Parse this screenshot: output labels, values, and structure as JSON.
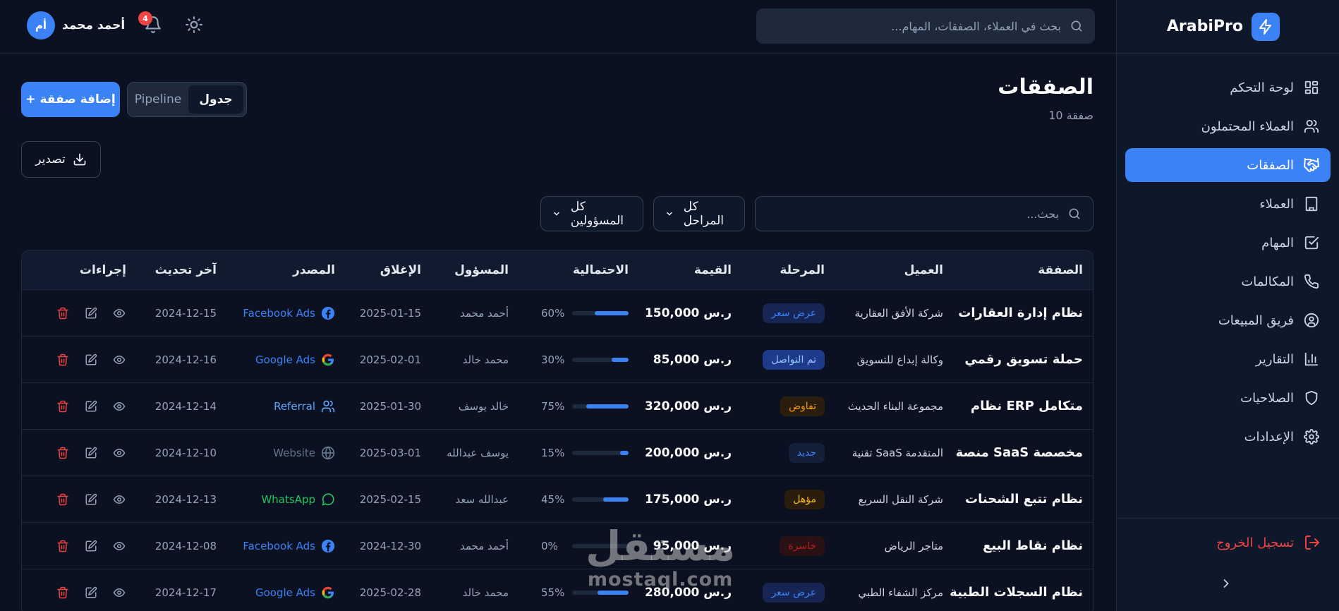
{
  "app": {
    "name": "ArabiPro"
  },
  "sidebar": {
    "items": [
      {
        "label": "لوحة التحكم",
        "icon": "dashboard-icon"
      },
      {
        "label": "العملاء المحتملون",
        "icon": "users-icon"
      },
      {
        "label": "الصفقات",
        "icon": "handshake-icon",
        "active": true
      },
      {
        "label": "العملاء",
        "icon": "building-icon"
      },
      {
        "label": "المهام",
        "icon": "checkbox-icon"
      },
      {
        "label": "المكالمات",
        "icon": "phone-icon"
      },
      {
        "label": "فريق المبيعات",
        "icon": "user-circle-icon"
      },
      {
        "label": "التقارير",
        "icon": "bar-chart-icon"
      },
      {
        "label": "الصلاحيات",
        "icon": "shield-icon"
      },
      {
        "label": "الإعدادات",
        "icon": "gear-icon"
      }
    ],
    "logout_label": "تسجيل الخروج"
  },
  "topbar": {
    "search_placeholder": "بحث في العملاء، الصفقات، المهام...",
    "user_name": "أحمد محمد",
    "user_initials": "أم",
    "notifications_count": "4"
  },
  "page": {
    "title": "الصفقات",
    "subtitle": "10 صفقة",
    "add_label": "+ إضافة صفقة",
    "view_table": "جدول",
    "view_pipeline": "Pipeline",
    "export_label": "تصدير"
  },
  "filters": {
    "search_placeholder": "بحث...",
    "stages_label": "كل المراحل",
    "owners_label": "كل المسؤولين"
  },
  "table": {
    "headers": {
      "deal": "الصفقة",
      "client": "العميل",
      "stage": "المرحلة",
      "value": "القيمة",
      "probability": "الاحتمالية",
      "owner": "المسؤول",
      "close": "الإغلاق",
      "source": "المصدر",
      "updated": "آخر تحديث",
      "actions": "إجراءات"
    },
    "rows": [
      {
        "deal": "نظام إدارة العقارات",
        "client": "شركة الأفق العقارية",
        "stage": "عرض سعر",
        "stage_style": "blue",
        "value": "150,000 ر.س",
        "prob": "60%",
        "prob_value": 60,
        "owner": "أحمد محمد",
        "close": "2025-01-15",
        "source": "Facebook Ads",
        "source_icon": "facebook-icon",
        "source_color": "#3b82f6",
        "updated": "2024-12-15"
      },
      {
        "deal": "حملة تسويق رقمي",
        "client": "وكالة إبداع للتسويق",
        "stage": "تم التواصل",
        "stage_style": "navy",
        "value": "85,000 ر.س",
        "prob": "30%",
        "prob_value": 30,
        "owner": "محمد خالد",
        "close": "2025-02-01",
        "source": "Google Ads",
        "source_icon": "google-icon",
        "source_color": "#3b82f6",
        "updated": "2024-12-16"
      },
      {
        "deal": "نظام ERP متكامل",
        "client": "مجموعة البناء الحديث",
        "stage": "تفاوض",
        "stage_style": "orange",
        "value": "320,000 ر.س",
        "prob": "75%",
        "prob_value": 75,
        "owner": "خالد يوسف",
        "close": "2025-01-30",
        "source": "Referral",
        "source_icon": "referral-users-icon",
        "source_color": "#60a5fa",
        "updated": "2024-12-14"
      },
      {
        "deal": "منصة SaaS مخصصة",
        "client": "تقنية SaaS المتقدمة",
        "stage": "جديد",
        "stage_style": "slate",
        "value": "200,000 ر.س",
        "prob": "15%",
        "prob_value": 15,
        "owner": "يوسف عبدالله",
        "close": "2025-03-01",
        "source": "Website",
        "source_icon": "globe-icon",
        "source_color": "#64748b",
        "updated": "2024-12-10"
      },
      {
        "deal": "نظام تتبع الشحنات",
        "client": "شركة النقل السريع",
        "stage": "مؤهل",
        "stage_style": "amber",
        "value": "175,000 ر.س",
        "prob": "45%",
        "prob_value": 45,
        "owner": "عبدالله سعد",
        "close": "2025-02-15",
        "source": "WhatsApp",
        "source_icon": "whatsapp-icon",
        "source_color": "#22c55e",
        "updated": "2024-12-13"
      },
      {
        "deal": "نظام نقاط البيع",
        "client": "متاجر الرياض",
        "stage": "خاسرة",
        "stage_style": "red",
        "value": "95,000 ر.س",
        "prob": "0%",
        "prob_value": 0,
        "owner": "أحمد محمد",
        "close": "2024-12-30",
        "source": "Facebook Ads",
        "source_icon": "facebook-icon",
        "source_color": "#3b82f6",
        "updated": "2024-12-08"
      },
      {
        "deal": "نظام السجلات الطبية",
        "client": "مركز الشفاء الطبي",
        "stage": "عرض سعر",
        "stage_style": "blue",
        "value": "280,000 ر.س",
        "prob": "55%",
        "prob_value": 55,
        "owner": "محمد خالد",
        "close": "2025-02-28",
        "source": "Google Ads",
        "source_icon": "google-icon",
        "source_color": "#3b82f6",
        "updated": "2024-12-17"
      }
    ]
  },
  "watermark": {
    "arabic": "مستقل",
    "latin": "mostaql.com"
  }
}
